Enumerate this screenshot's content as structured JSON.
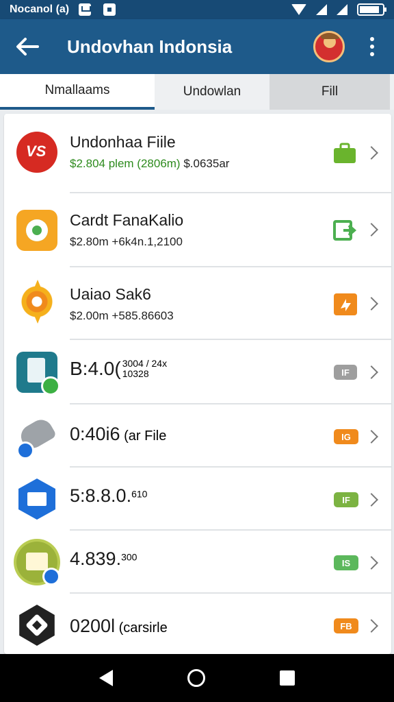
{
  "status_bar": {
    "carrier": "Nocanol (a)"
  },
  "app_bar": {
    "title": "Undovhan Indonsia",
    "back_icon": "arrow-left-icon",
    "menu_icon": "more-vertical-icon"
  },
  "tabs": [
    {
      "label": "Nmallaams",
      "active": true
    },
    {
      "label": "Undowlan",
      "active": false
    },
    {
      "label": "Fill",
      "active": false
    }
  ],
  "items": [
    {
      "title": "Undonhaa Fiile",
      "subtitle_green": "$2.804 plem (2806m)",
      "subtitle": " $.0635ar",
      "icon": "vs-logo-icon",
      "badge_icon": "briefcase-icon",
      "badge_color": "#6ab42d"
    },
    {
      "title": "Cardt FanaKalio",
      "subtitle_green": "",
      "subtitle": "$2.80m +6k4n.1,2100",
      "icon": "leaf-logo-icon",
      "badge_icon": "export-icon",
      "badge_color": "#4caf50"
    },
    {
      "title": "Uaiao Sak6",
      "subtitle_green": "",
      "subtitle": "$2.00m +585.86603",
      "icon": "sun-logo-icon",
      "badge_icon": "share-icon",
      "badge_color": "#f08a1c"
    },
    {
      "title": "B:4.0(",
      "title_small": "3004 / 24x 10328",
      "subtitle_green": "",
      "subtitle": "",
      "icon": "calculator-icon",
      "badge": "IF",
      "badge_color": "#9e9e9e"
    },
    {
      "title": "0:40i6",
      "title_suffix": " (ar File",
      "subtitle_green": "",
      "subtitle": "",
      "icon": "camera-icon",
      "badge": "IG",
      "badge_color": "#f08a1c"
    },
    {
      "title": "5:8.8.0.",
      "title_sup": "610",
      "subtitle_green": "",
      "subtitle": "",
      "icon": "mail-icon",
      "badge": "IF",
      "badge_color": "#7cb342"
    },
    {
      "title": "4.839.",
      "title_sup": "300",
      "subtitle_green": "",
      "subtitle": "",
      "icon": "certificate-icon",
      "badge": "IS",
      "badge_color": "#5cb85c"
    },
    {
      "title": "0200l",
      "title_suffix": " (carsirle",
      "subtitle_green": "",
      "subtitle": "",
      "icon": "shield-icon",
      "badge": "FB",
      "badge_color": "#f08a1c"
    }
  ]
}
